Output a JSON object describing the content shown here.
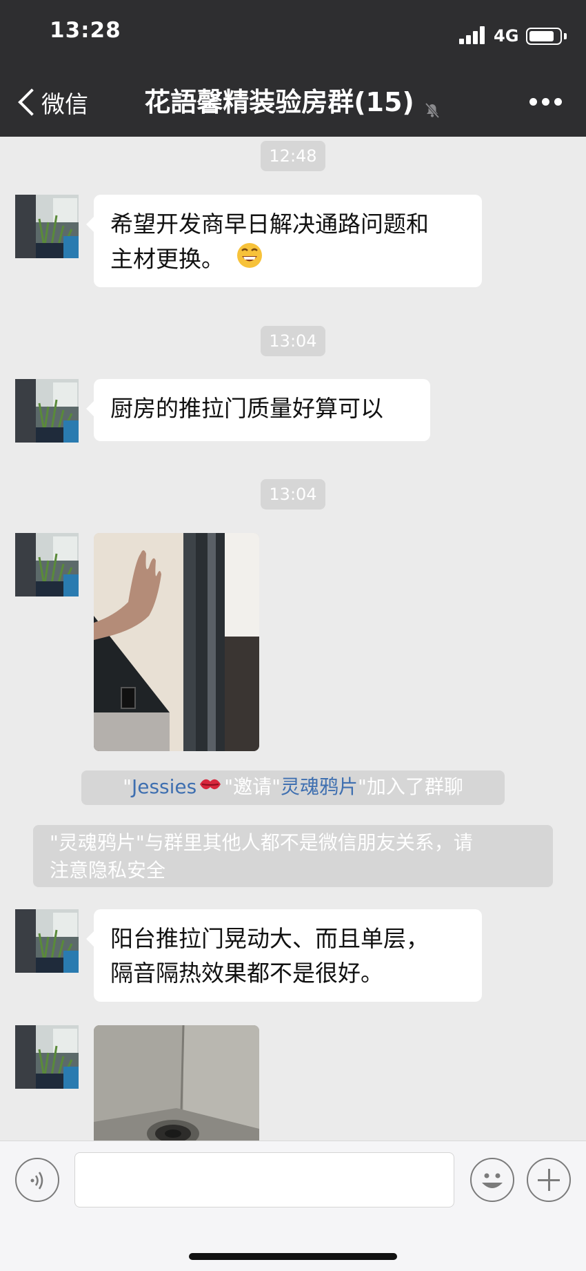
{
  "status": {
    "time": "13:28",
    "network": "4G",
    "battery_level": 0.8
  },
  "nav": {
    "back_label": "微信",
    "title": "花語馨精装验房群(15)"
  },
  "messages": [
    {
      "type": "time",
      "text": "12:48"
    },
    {
      "type": "text",
      "lines": [
        "希望开发商早日解决通路问题和",
        "主材更换。"
      ],
      "emoji": "grinning-face"
    },
    {
      "type": "time",
      "text": "13:04"
    },
    {
      "type": "text",
      "lines": [
        "厨房的推拉门质量好算可以"
      ]
    },
    {
      "type": "time",
      "text": "13:04"
    },
    {
      "type": "image",
      "subject": "hand at sliding door"
    },
    {
      "type": "system",
      "parts": [
        "\"",
        "Jessies",
        "\"邀请\"",
        "灵魂鸦片",
        "\"加入了群聊"
      ]
    },
    {
      "type": "system",
      "lines": [
        "\"灵魂鸦片\"与群里其他人都不是微信朋友关系，请",
        "注意隐私安全"
      ]
    },
    {
      "type": "text",
      "lines": [
        "阳台推拉门晃动大、而且单层，",
        "隔音隔热效果都不是很好。"
      ]
    },
    {
      "type": "image",
      "subject": "floor drain in corner"
    }
  ],
  "input": {
    "voice_icon": "voice-icon",
    "emoji_icon": "emoji-icon",
    "plus_icon": "plus-icon"
  },
  "colors": {
    "header_bg": "#2e2e30",
    "chat_bg": "#ebebeb",
    "timestamp_bg": "#d6d6d6",
    "link_blue": "#3e6fb0"
  }
}
